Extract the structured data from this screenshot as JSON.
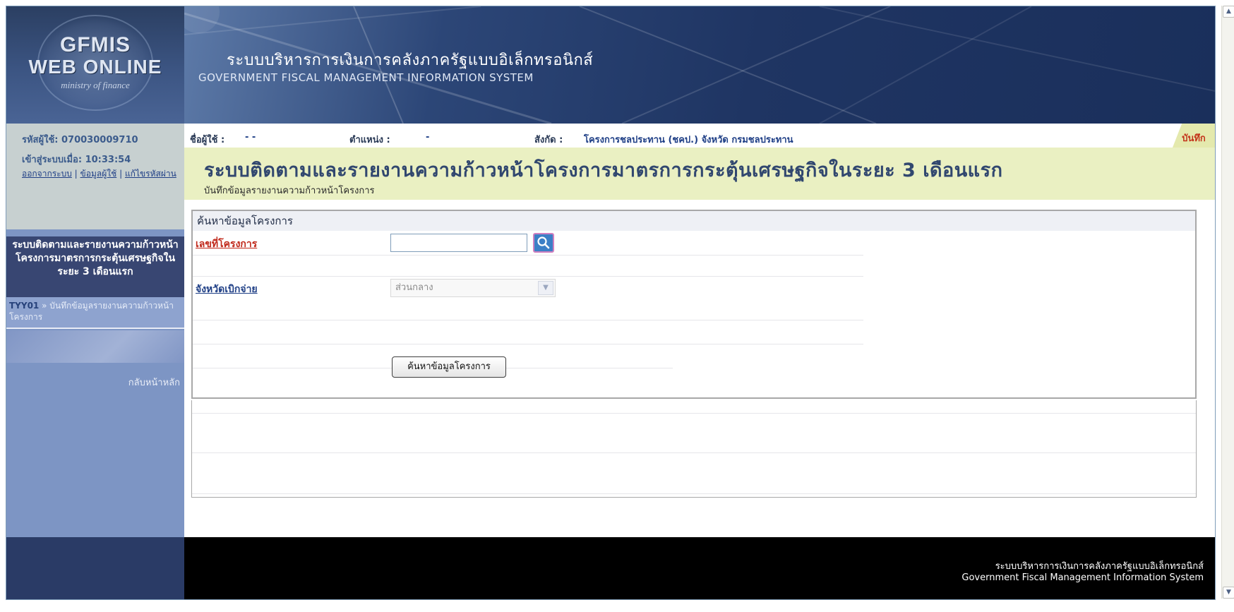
{
  "header": {
    "logo": {
      "line1": "GFMIS",
      "line2": "WEB ONLINE",
      "line3": "ministry of finance"
    },
    "system_name_th": "ระบบบริหารการเงินการคลังภาครัฐแบบอิเล็กทรอนิกส์",
    "system_name_en": "GOVERNMENT FISCAL MANAGEMENT INFORMATION SYSTEM"
  },
  "user": {
    "code_label": "รหัสผู้ใช้: 070030009710",
    "login_label": "เข้าสู่ระบบเมื่อ: 10:33:54",
    "links": {
      "logout": "ออกจากระบบ",
      "user_info": "ข้อมูลผู้ใช้",
      "change_password": "แก้ไขรหัสผ่าน"
    }
  },
  "sidebar": {
    "menu_title": "ระบบติดตามและรายงานความก้าวหน้าโครงการมาตรการกระตุ้นเศรษฐกิจในระยะ 3 เดือนแรก",
    "menu_item": {
      "code": "TYY01",
      "label": "» บันทึกข้อมูลรายงานความก้าวหน้าโครงการ"
    },
    "back_home": "กลับหน้าหลัก"
  },
  "infobar": {
    "username_label": "ชื่อผู้ใช้ :",
    "username_value": "- -",
    "position_label": "ตำแหน่ง :",
    "position_value": "-",
    "affiliation_label": "สังกัด :",
    "affiliation_value": "โครงการชลประทาน (ชคป.) จังหวัด กรมชลประทาน",
    "save_tab": "บันทึก"
  },
  "page": {
    "title": "ระบบติดตามและรายงานความก้าวหน้าโครงการมาตรการกระตุ้นเศรษฐกิจในระยะ 3 เดือนแรก",
    "subtitle": "บันทึกข้อมูลรายงานความก้าวหน้าโครงการ"
  },
  "search": {
    "header": "ค้นหาข้อมูลโครงการ",
    "project_no_label": "เลขที่โครงการ",
    "project_no_value": "",
    "province_label": "จังหวัดเบิกจ่าย",
    "province_selected": "ส่วนกลาง",
    "submit_label": "ค้นหาข้อมูลโครงการ"
  },
  "footer": {
    "line_th": "ระบบบริหารการเงินการคลังภาครัฐแบบอิเล็กทรอนิกส์",
    "line_en": "Government Fiscal Management Information System"
  }
}
